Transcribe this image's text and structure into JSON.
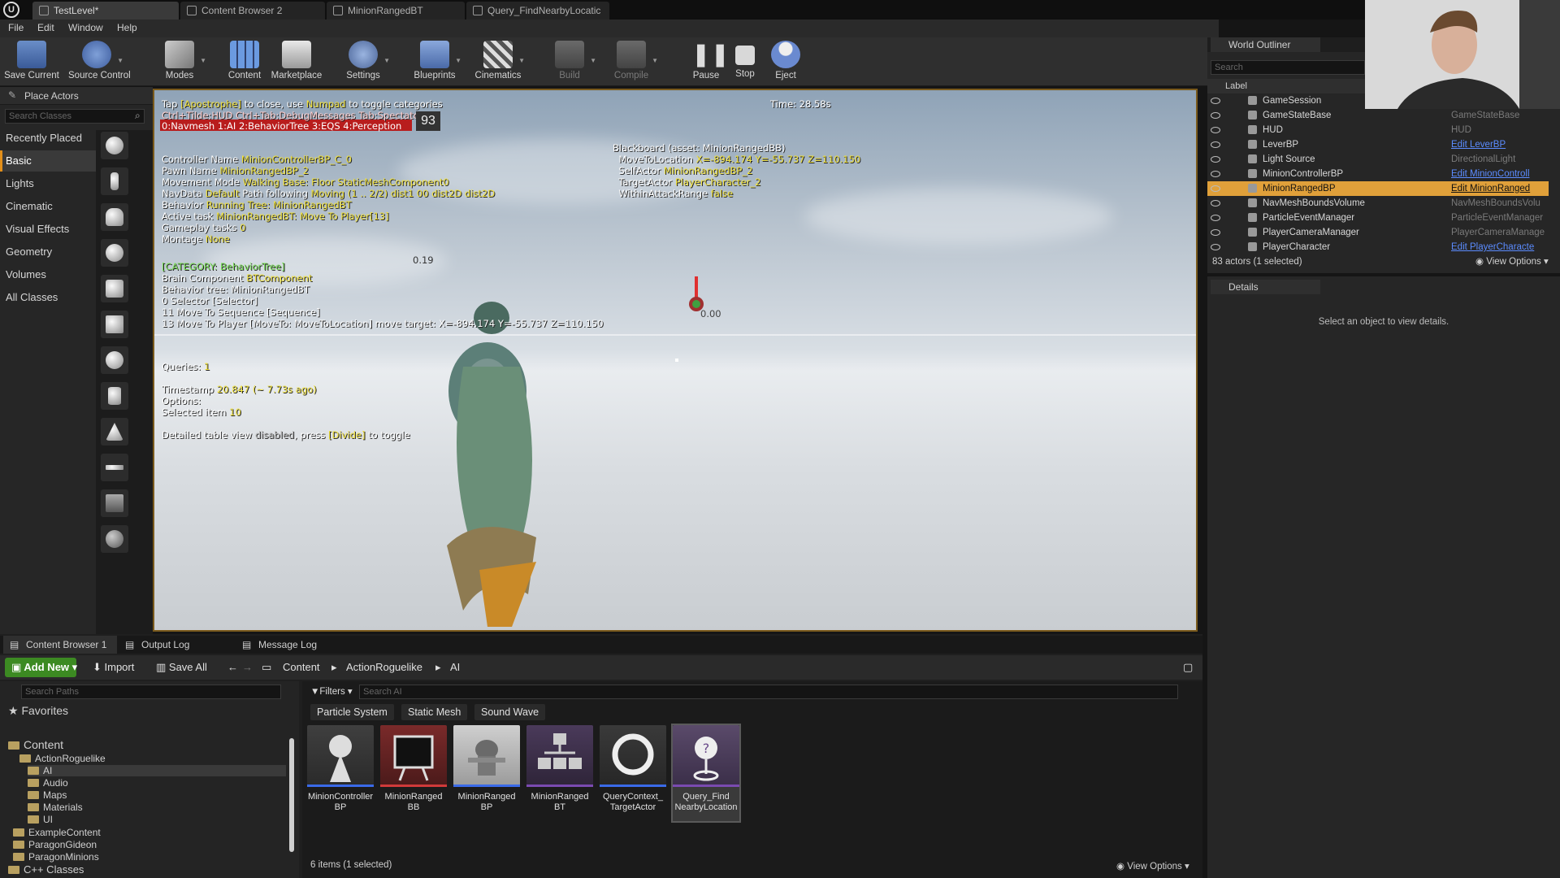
{
  "window": {
    "tabs": [
      {
        "label": "TestLevel*"
      },
      {
        "label": "Content Browser 2"
      },
      {
        "label": "MinionRangedBT"
      },
      {
        "label": "Query_FindNearbyLocatic"
      }
    ]
  },
  "menu": {
    "items": [
      "File",
      "Edit",
      "Window",
      "Help"
    ]
  },
  "toolbar": {
    "buttons": [
      {
        "label": "Save Current",
        "icon": "save-icon"
      },
      {
        "label": "Source Control",
        "icon": "source-control-icon"
      },
      {
        "label": "Modes",
        "icon": "modes-icon"
      },
      {
        "label": "Content",
        "icon": "content-icon"
      },
      {
        "label": "Marketplace",
        "icon": "marketplace-icon"
      },
      {
        "label": "Settings",
        "icon": "settings-icon"
      },
      {
        "label": "Blueprints",
        "icon": "blueprints-icon"
      },
      {
        "label": "Cinematics",
        "icon": "cinematics-icon"
      },
      {
        "label": "Build",
        "icon": "build-icon"
      },
      {
        "label": "Compile",
        "icon": "compile-icon"
      },
      {
        "label": "Pause",
        "icon": "pause-icon"
      },
      {
        "label": "Stop",
        "icon": "stop-icon"
      },
      {
        "label": "Eject",
        "icon": "eject-icon"
      }
    ]
  },
  "place_actors": {
    "title": "Place Actors",
    "search_placeholder": "Search Classes",
    "categories": [
      "Recently Placed",
      "Basic",
      "Lights",
      "Cinematic",
      "Visual Effects",
      "Geometry",
      "Volumes",
      "All Classes"
    ],
    "selected": "Basic"
  },
  "viewport": {
    "hint_line1_a": "Tap ",
    "hint_line1_b": "[Apostrophe]",
    "hint_line1_c": " to close, use ",
    "hint_line1_d": "Numpad",
    "hint_line1_e": " to toggle categories",
    "hint_line2": "Ctrl+Tilde:HUD  Ctrl+Tab:DebugMessages  Tab:Spectator",
    "hint_line3": "0:Navmesh  1:AI  2:BehaviorTree  3:EQS  4:Perception",
    "fps": "93",
    "time": "Time: 28.58s",
    "ai": {
      "controller_label": "Controller Name ",
      "controller": "MinionControllerBP_C_0",
      "pawn_label": "Pawn Name ",
      "pawn": "MinionRangedBP_2",
      "movement_label": "Movement Mode ",
      "movement": "Walking Base: Floor StaticMeshComponent0",
      "navdata_label": "NavData ",
      "navdata": "Default",
      "navdata_b": "  Path following ",
      "navdata_c": "Moving (1 .. 2/2) dist1 00 dist2D dist2D",
      "behavior_label": "Behavior ",
      "behavior": "Running Tree: MinionRangedBT",
      "task_label": "Active task ",
      "task": "MinionRangedBT: Move To Player[13]",
      "gameplay_label": "Gameplay tasks ",
      "gameplay": "0",
      "montage_label": "Montage ",
      "montage": "None"
    },
    "bt": {
      "category": "[CATEGORY: BehaviorTree]",
      "brain_label": "Brain Component ",
      "brain": "BTComponent",
      "tree": "Behavior tree: MinionRangedBT",
      "n0": "0  Selector [Selector]",
      "n11": "11  Move To Sequence [Sequence]",
      "n13": "13  Move To Player [MoveTo: MoveToLocation]  move target: X=-894.174 Y=-55.737 Z=110.150"
    },
    "eqs": {
      "queries_label": "Queries: ",
      "queries": "1",
      "timestamp_label": "Timestamp ",
      "timestamp": "20.847 (~ 7.73s ago)",
      "options_label": "Options: ",
      "selected_label": "Selected item ",
      "selected": "10",
      "detail_a": "Detailed table view ",
      "detail_b": "disabled",
      "detail_c": ", press ",
      "detail_d": "[Divide]",
      "detail_e": " to toggle"
    },
    "blackboard": {
      "title": "Blackboard (asset: MinionRangedBB)",
      "move_label": "MoveToLocation ",
      "move": "X=-894.174 Y=-55.737 Z=110.150",
      "self_label": "SelfActor ",
      "self": "MinionRangedBP_2",
      "target_label": "TargetActor ",
      "target": "PlayerCharacter_2",
      "within_label": "WithinAttackRange ",
      "within": "false"
    },
    "marker_a": "0.19",
    "marker_b": "0.00"
  },
  "outliner": {
    "title": "World Outliner",
    "search_placeholder": "Search",
    "column": "Label",
    "rows": [
      {
        "name": "GameSession",
        "type": "GameSession",
        "link": false
      },
      {
        "name": "GameStateBase",
        "type": "GameStateBase",
        "link": false
      },
      {
        "name": "HUD",
        "type": "HUD",
        "link": false
      },
      {
        "name": "LeverBP",
        "type": "Edit LeverBP",
        "link": true
      },
      {
        "name": "Light Source",
        "type": "DirectionalLight",
        "link": false
      },
      {
        "name": "MinionControllerBP",
        "type": "Edit MinionControll",
        "link": true
      },
      {
        "name": "MinionRangedBP",
        "type": "Edit MinionRanged",
        "link": true
      },
      {
        "name": "NavMeshBoundsVolume",
        "type": "NavMeshBoundsVolu",
        "link": false
      },
      {
        "name": "ParticleEventManager",
        "type": "ParticleEventManager",
        "link": false
      },
      {
        "name": "PlayerCameraManager",
        "type": "PlayerCameraManage",
        "link": false
      },
      {
        "name": "PlayerCharacter",
        "type": "Edit PlayerCharacte",
        "link": true
      }
    ],
    "footer": "83 actors (1 selected)",
    "view_options": "View Options"
  },
  "details": {
    "title": "Details",
    "empty_message": "Select an object to view details."
  },
  "content_browser": {
    "tabs": [
      "Content Browser 1",
      "Output Log",
      "Message Log"
    ],
    "add_new": "Add New",
    "import": "Import",
    "save_all": "Save All",
    "breadcrumb": [
      "Content",
      "ActionRoguelike",
      "AI"
    ],
    "path_search_placeholder": "Search Paths",
    "favorites": "Favorites",
    "tree": [
      "Content",
      "ActionRoguelike",
      "AI",
      "Audio",
      "Maps",
      "Materials",
      "UI",
      "ExampleContent",
      "ParagonGideon",
      "ParagonMinions",
      "C++ Classes"
    ],
    "filters_label": "Filters",
    "asset_search_placeholder": "Search AI",
    "filter_chips": [
      "Particle System",
      "Static Mesh",
      "Sound Wave"
    ],
    "assets": [
      {
        "name": "MinionController\nBP",
        "color": "#3a6ae8"
      },
      {
        "name": "MinionRanged\nBB",
        "color": "#d03a3a"
      },
      {
        "name": "MinionRanged\nBP",
        "color": "#3a6ae8"
      },
      {
        "name": "MinionRanged\nBT",
        "color": "#7a4ab0"
      },
      {
        "name": "QueryContext_\nTargetActor",
        "color": "#3a6ae8"
      },
      {
        "name": "Query_Find\nNearbyLocation",
        "color": "#7a4ab0"
      }
    ],
    "items_count": "6 items (1 selected)",
    "view_options": "View Options"
  },
  "colors": {
    "accent": "#e0a03a",
    "add_new": "#3c8a22",
    "link": "#5b8cff"
  }
}
